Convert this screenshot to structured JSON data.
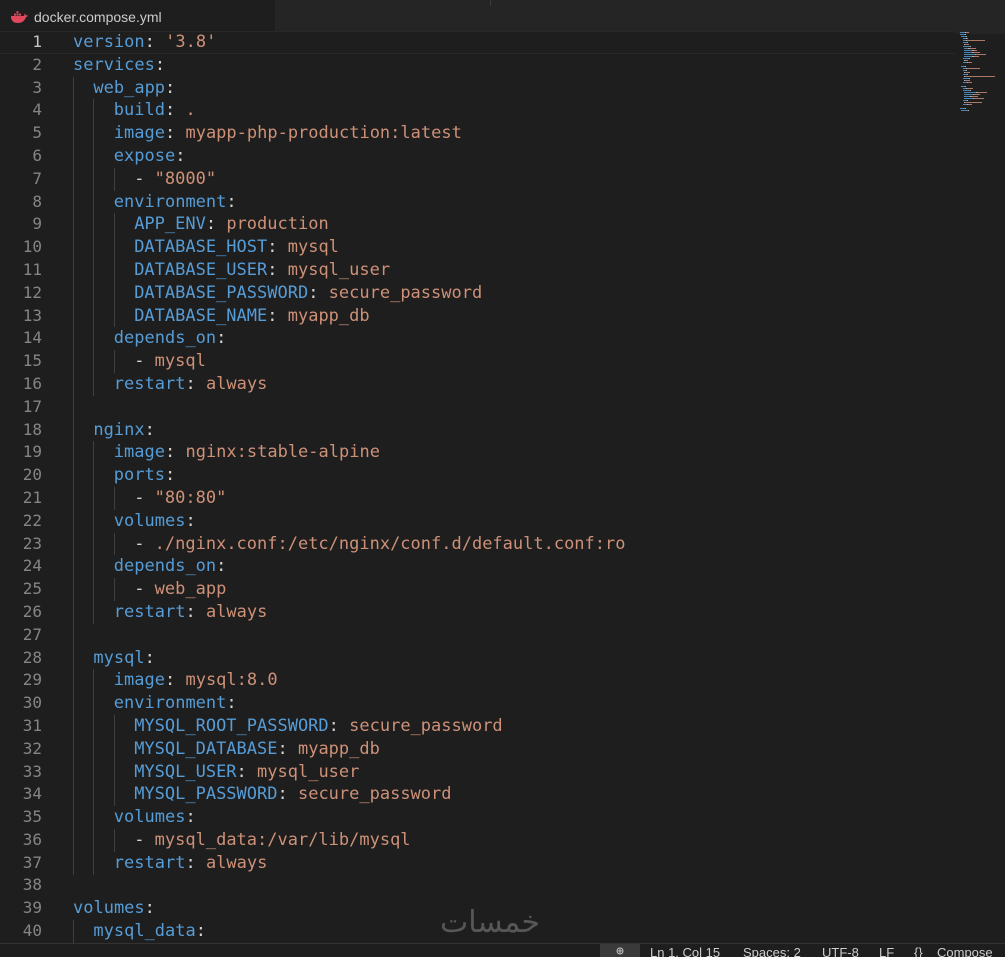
{
  "tab": {
    "filename": "docker.compose.yml",
    "icon": "docker-icon"
  },
  "colors": {
    "key": "#569cd6",
    "punctuation": "#d4d4d4",
    "value": "#ce9178",
    "background": "#1e1e1e",
    "line_number": "#858585"
  },
  "current_line": 1,
  "code_lines": [
    {
      "n": "1",
      "indent": 0,
      "key": "version",
      "sep": ": ",
      "value": "'3.8'"
    },
    {
      "n": "2",
      "indent": 0,
      "key": "services",
      "sep": ":",
      "value": ""
    },
    {
      "n": "3",
      "indent": 1,
      "key": "web_app",
      "sep": ":",
      "value": ""
    },
    {
      "n": "4",
      "indent": 2,
      "key": "build",
      "sep": ": ",
      "value": "."
    },
    {
      "n": "5",
      "indent": 2,
      "key": "image",
      "sep": ": ",
      "value": "myapp-php-production:latest"
    },
    {
      "n": "6",
      "indent": 2,
      "key": "expose",
      "sep": ":",
      "value": ""
    },
    {
      "n": "7",
      "indent": 3,
      "dash": "- ",
      "value": "\"8000\""
    },
    {
      "n": "8",
      "indent": 2,
      "key": "environment",
      "sep": ":",
      "value": ""
    },
    {
      "n": "9",
      "indent": 3,
      "key": "APP_ENV",
      "sep": ": ",
      "value": "production"
    },
    {
      "n": "10",
      "indent": 3,
      "key": "DATABASE_HOST",
      "sep": ": ",
      "value": "mysql"
    },
    {
      "n": "11",
      "indent": 3,
      "key": "DATABASE_USER",
      "sep": ": ",
      "value": "mysql_user"
    },
    {
      "n": "12",
      "indent": 3,
      "key": "DATABASE_PASSWORD",
      "sep": ": ",
      "value": "secure_password"
    },
    {
      "n": "13",
      "indent": 3,
      "key": "DATABASE_NAME",
      "sep": ": ",
      "value": "myapp_db"
    },
    {
      "n": "14",
      "indent": 2,
      "key": "depends_on",
      "sep": ":",
      "value": ""
    },
    {
      "n": "15",
      "indent": 3,
      "dash": "- ",
      "value": "mysql"
    },
    {
      "n": "16",
      "indent": 2,
      "key": "restart",
      "sep": ": ",
      "value": "always"
    },
    {
      "n": "17",
      "indent": 0,
      "value": ""
    },
    {
      "n": "18",
      "indent": 1,
      "key": "nginx",
      "sep": ":",
      "value": ""
    },
    {
      "n": "19",
      "indent": 2,
      "key": "image",
      "sep": ": ",
      "value": "nginx:stable-alpine"
    },
    {
      "n": "20",
      "indent": 2,
      "key": "ports",
      "sep": ":",
      "value": ""
    },
    {
      "n": "21",
      "indent": 3,
      "dash": "- ",
      "value": "\"80:80\""
    },
    {
      "n": "22",
      "indent": 2,
      "key": "volumes",
      "sep": ":",
      "value": ""
    },
    {
      "n": "23",
      "indent": 3,
      "dash": "- ",
      "value": "./nginx.conf:/etc/nginx/conf.d/default.conf:ro"
    },
    {
      "n": "24",
      "indent": 2,
      "key": "depends_on",
      "sep": ":",
      "value": ""
    },
    {
      "n": "25",
      "indent": 3,
      "dash": "- ",
      "value": "web_app"
    },
    {
      "n": "26",
      "indent": 2,
      "key": "restart",
      "sep": ": ",
      "value": "always"
    },
    {
      "n": "27",
      "indent": 0,
      "value": ""
    },
    {
      "n": "28",
      "indent": 1,
      "key": "mysql",
      "sep": ":",
      "value": ""
    },
    {
      "n": "29",
      "indent": 2,
      "key": "image",
      "sep": ": ",
      "value": "mysql:8.0"
    },
    {
      "n": "30",
      "indent": 2,
      "key": "environment",
      "sep": ":",
      "value": ""
    },
    {
      "n": "31",
      "indent": 3,
      "key": "MYSQL_ROOT_PASSWORD",
      "sep": ": ",
      "value": "secure_password"
    },
    {
      "n": "32",
      "indent": 3,
      "key": "MYSQL_DATABASE",
      "sep": ": ",
      "value": "myapp_db"
    },
    {
      "n": "33",
      "indent": 3,
      "key": "MYSQL_USER",
      "sep": ": ",
      "value": "mysql_user"
    },
    {
      "n": "34",
      "indent": 3,
      "key": "MYSQL_PASSWORD",
      "sep": ": ",
      "value": "secure_password"
    },
    {
      "n": "35",
      "indent": 2,
      "key": "volumes",
      "sep": ":",
      "value": ""
    },
    {
      "n": "36",
      "indent": 3,
      "dash": "- ",
      "value": "mysql_data:/var/lib/mysql"
    },
    {
      "n": "37",
      "indent": 2,
      "key": "restart",
      "sep": ": ",
      "value": "always"
    },
    {
      "n": "38",
      "indent": 0,
      "value": ""
    },
    {
      "n": "39",
      "indent": 0,
      "key": "volumes",
      "sep": ":",
      "value": ""
    },
    {
      "n": "40",
      "indent": 1,
      "key": "mysql_data",
      "sep": ":",
      "value": ""
    }
  ],
  "watermark": "خمسات",
  "status_bar": {
    "icon": "zoom-icon",
    "position": "Ln 1, Col 15",
    "spaces": "Spaces: 2",
    "encoding": "UTF-8",
    "eol": "LF",
    "language_icon": "braces-icon",
    "language": "Compose"
  }
}
